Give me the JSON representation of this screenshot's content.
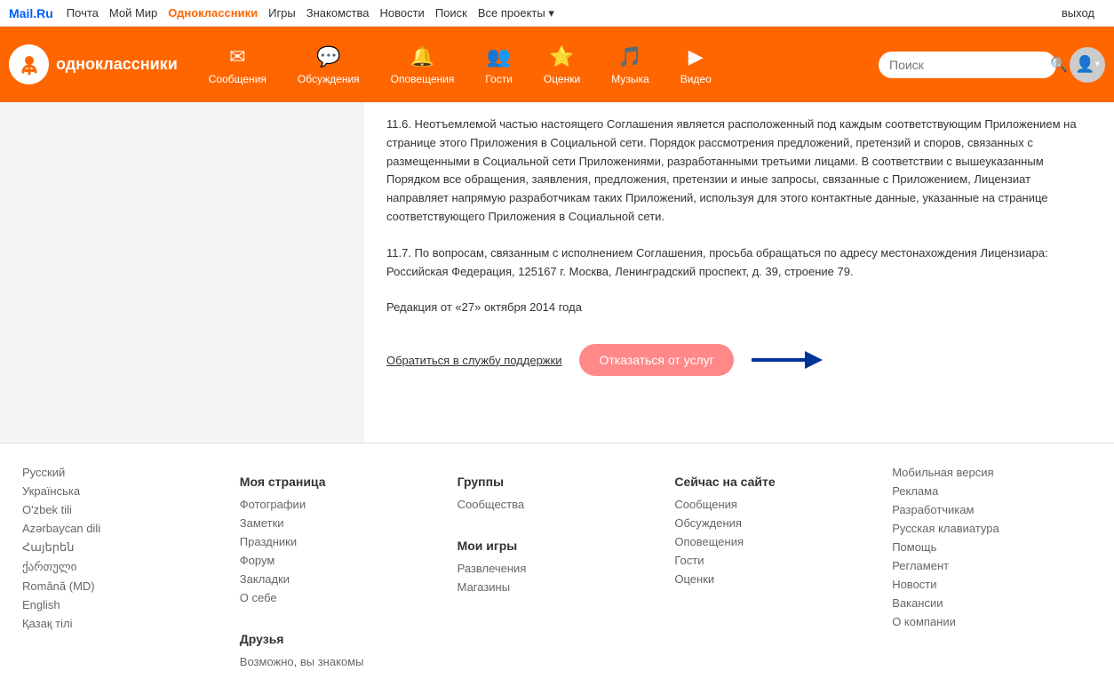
{
  "top_nav": {
    "logo": "Mail.Ru",
    "links": [
      "Почта",
      "Мой Мир",
      "Одноклассники",
      "Игры",
      "Знакомства",
      "Новости",
      "Поиск",
      "Все проекты"
    ],
    "active": "Одноклассники",
    "logout": "выход"
  },
  "ok_header": {
    "logo_text": "одноклассники",
    "nav_items": [
      {
        "icon": "✉",
        "label": "Сообщения"
      },
      {
        "icon": "💬",
        "label": "Обсуждения"
      },
      {
        "icon": "🔔",
        "label": "Оповещения"
      },
      {
        "icon": "👥",
        "label": "Гости"
      },
      {
        "icon": "⭐",
        "label": "Оценки"
      },
      {
        "icon": "🎵",
        "label": "Музыка"
      },
      {
        "icon": "▶",
        "label": "Видео"
      }
    ],
    "search_placeholder": "Поиск"
  },
  "content": {
    "paragraph1": "11.6. Неотъемлемой частью настоящего Соглашения является расположенный под каждым соответствующим Приложением на странице этого Приложения в Социальной сети. Порядок рассмотрения предложений, претензий и споров, связанных с размещенными в Социальной сети Приложениями, разработанными третьими лицами. В соответствии с вышеуказанным Порядком все обращения, заявления, предложения, претензии и иные запросы, связанные с Приложением, Лицензиат направляет напрямую разработчикам таких Приложений, используя для этого контактные данные, указанные на странице соответствующего Приложения в Социальной сети.",
    "paragraph2": "11.7. По вопросам, связанным с исполнением Соглашения, просьба обращаться по адресу местонахождения Лицензиара: Российская Федерация, 125167 г. Москва, Ленинградский проспект, д. 39, строение 79.",
    "revision": "Редакция от «27» октября 2014 года",
    "support_link": "Обратиться в службу поддержки",
    "cancel_button": "Отказаться от услуг"
  },
  "footer": {
    "languages": {
      "title": "Русский",
      "items": [
        "Українська",
        "O'zbek tili",
        "Azərbaycan dili",
        "Հայերեն",
        "ქართული",
        "Română (MD)",
        "English",
        "Қазақ тілі"
      ]
    },
    "my_page": {
      "title": "Моя страница",
      "items": [
        "Фотографии",
        "Заметки",
        "Праздники",
        "Форум",
        "Закладки",
        "О себе"
      ]
    },
    "groups": {
      "title": "Группы",
      "items": [
        "Сообщества"
      ]
    },
    "my_games": {
      "title": "Мои игры",
      "items": [
        "Развлечения",
        "Магазины"
      ]
    },
    "now_on_site": {
      "title": "Сейчас на сайте",
      "items": [
        "Сообщения",
        "Обсуждения",
        "Оповещения",
        "Гости",
        "Оценки"
      ]
    },
    "misc": {
      "items": [
        "Мобильная версия",
        "Реклама",
        "Разработчикам",
        "Русская клавиатура",
        "Помощь",
        "Регламент",
        "Новости",
        "Вакансии",
        "О компании"
      ]
    },
    "friends": {
      "title": "Друзья",
      "items": [
        "Возможно, вы знакомы"
      ]
    }
  }
}
